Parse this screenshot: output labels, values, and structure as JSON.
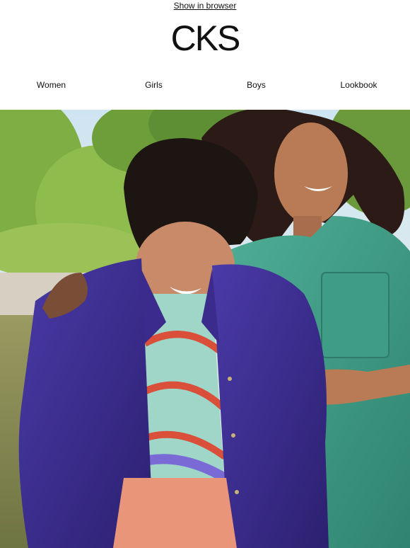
{
  "header": {
    "browser_link": "Show in browser",
    "logo_text": "CKS"
  },
  "nav": {
    "items": [
      {
        "label": "Women"
      },
      {
        "label": "Girls"
      },
      {
        "label": "Boys"
      },
      {
        "label": "Lookbook"
      }
    ]
  },
  "colors": {
    "background": "#ffffff",
    "text": "#111111",
    "jacket_blue": "#3a2b8c",
    "shirt_green": "#3e9a86",
    "pants_salmon": "#e9957a",
    "foliage_green": "#7fae45"
  }
}
